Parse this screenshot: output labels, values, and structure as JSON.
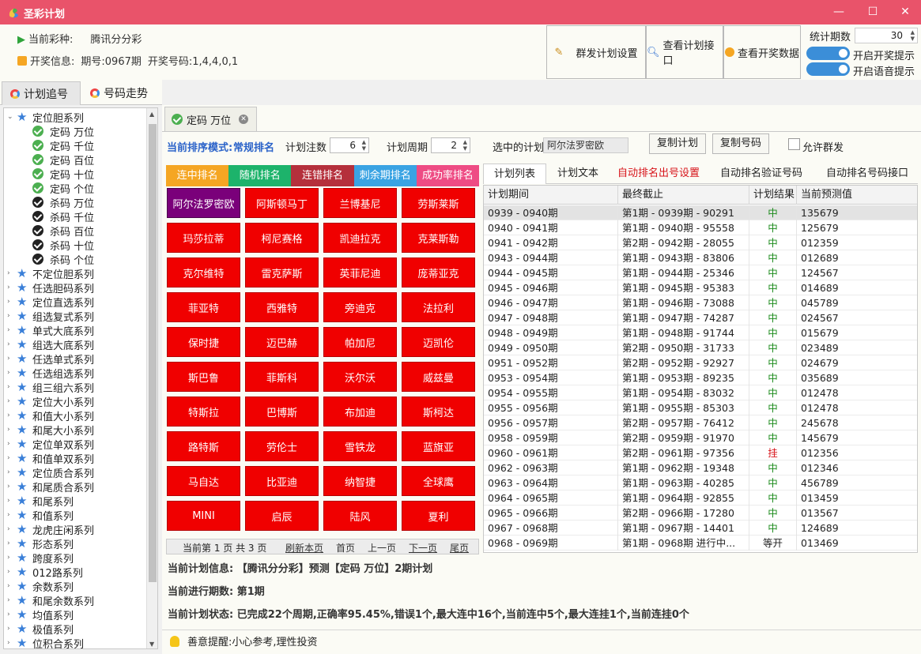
{
  "app": {
    "title": "圣彩计划"
  },
  "window": {
    "minimize": "—",
    "maximize": "☐",
    "close": "✕"
  },
  "info": {
    "lottery_label": "当前彩种:",
    "lottery_value": "腾讯分分彩",
    "draw_label": "开奖信息:",
    "draw_issue": "期号:0967期",
    "draw_code": "开奖号码:1,4,4,0,1"
  },
  "toolbar": {
    "group_settings": "群发计划设置",
    "view_api": "查看计划接口",
    "view_data": "查看开奖数据",
    "stat_label": "统计期数",
    "stat_value": "30",
    "toggle1": "开启开奖提示",
    "toggle2": "开启语音提示"
  },
  "left_tabs": [
    "计划追号",
    "号码走势"
  ],
  "tree": [
    {
      "label": "定位胆系列",
      "type": "group",
      "expanded": true
    },
    {
      "label": "定码 万位",
      "type": "child",
      "check": "green"
    },
    {
      "label": "定码 千位",
      "type": "child",
      "check": "green"
    },
    {
      "label": "定码 百位",
      "type": "child",
      "check": "green"
    },
    {
      "label": "定码 十位",
      "type": "child",
      "check": "green"
    },
    {
      "label": "定码 个位",
      "type": "child",
      "check": "green"
    },
    {
      "label": "杀码 万位",
      "type": "child",
      "check": "black"
    },
    {
      "label": "杀码 千位",
      "type": "child",
      "check": "black"
    },
    {
      "label": "杀码 百位",
      "type": "child",
      "check": "black"
    },
    {
      "label": "杀码 十位",
      "type": "child",
      "check": "black"
    },
    {
      "label": "杀码 个位",
      "type": "child",
      "check": "black"
    },
    {
      "label": "不定位胆系列",
      "type": "group"
    },
    {
      "label": "任选胆码系列",
      "type": "group"
    },
    {
      "label": "定位直选系列",
      "type": "group"
    },
    {
      "label": "组选复式系列",
      "type": "group"
    },
    {
      "label": "单式大底系列",
      "type": "group"
    },
    {
      "label": "组选大底系列",
      "type": "group"
    },
    {
      "label": "任选单式系列",
      "type": "group"
    },
    {
      "label": "任选组选系列",
      "type": "group"
    },
    {
      "label": "组三组六系列",
      "type": "group"
    },
    {
      "label": "定位大小系列",
      "type": "group"
    },
    {
      "label": "和值大小系列",
      "type": "group"
    },
    {
      "label": "和尾大小系列",
      "type": "group"
    },
    {
      "label": "定位单双系列",
      "type": "group"
    },
    {
      "label": "和值单双系列",
      "type": "group"
    },
    {
      "label": "定位质合系列",
      "type": "group"
    },
    {
      "label": "和尾质合系列",
      "type": "group"
    },
    {
      "label": "和尾系列",
      "type": "group"
    },
    {
      "label": "和值系列",
      "type": "group"
    },
    {
      "label": "龙虎庄闲系列",
      "type": "group"
    },
    {
      "label": "形态系列",
      "type": "group"
    },
    {
      "label": "跨度系列",
      "type": "group"
    },
    {
      "label": "012路系列",
      "type": "group"
    },
    {
      "label": "余数系列",
      "type": "group"
    },
    {
      "label": "和尾余数系列",
      "type": "group"
    },
    {
      "label": "均值系列",
      "type": "group"
    },
    {
      "label": "极值系列",
      "type": "group"
    },
    {
      "label": "位积合系列",
      "type": "group"
    }
  ],
  "plan_tab": "定码 万位",
  "controls": {
    "mode_label": "当前排序模式:",
    "mode_value": "常规排名",
    "bets_label": "计划注数",
    "bets_value": "6",
    "cycle_label": "计划周期",
    "cycle_value": "2",
    "selected_label": "选中的计划",
    "selected_value": "阿尔法罗密欧",
    "copy_plan": "复制计划",
    "copy_code": "复制号码",
    "allow_group": "允许群发"
  },
  "rank_tabs": [
    {
      "label": "连中排名",
      "color": "#f5a623"
    },
    {
      "label": "随机排名",
      "color": "#1db36b"
    },
    {
      "label": "连错排名",
      "color": "#b5303c"
    },
    {
      "label": "刺余期排名",
      "color": "#3aa3e3"
    },
    {
      "label": "成功率排名",
      "color": "#ee4c84"
    }
  ],
  "plans": [
    "阿尔法罗密欧",
    "阿斯顿马丁",
    "兰博基尼",
    "劳斯莱斯",
    "玛莎拉蒂",
    "柯尼赛格",
    "凯迪拉克",
    "克莱斯勒",
    "克尔维特",
    "雷克萨斯",
    "英菲尼迪",
    "庞蒂亚克",
    "菲亚特",
    "西雅特",
    "旁迪克",
    "法拉利",
    "保时捷",
    "迈巴赫",
    "帕加尼",
    "迈凯伦",
    "斯巴鲁",
    "菲斯科",
    "沃尔沃",
    "威兹曼",
    "特斯拉",
    "巴博斯",
    "布加迪",
    "斯柯达",
    "路特斯",
    "劳伦士",
    "雪铁龙",
    "蓝旗亚",
    "马自达",
    "比亚迪",
    "纳智捷",
    "全球鹰",
    "MINI",
    "启辰",
    "陆风",
    "夏利"
  ],
  "pager": {
    "status": "当前第 1 页 共 3 页",
    "refresh": "刷新本页",
    "first": "首页",
    "prev": "上一页",
    "next": "下一页",
    "last": "尾页"
  },
  "list_tabs": [
    "计划列表",
    "计划文本",
    "自动排名出号设置",
    "自动排名验证号码",
    "自动排名号码接口"
  ],
  "table": {
    "headers": [
      "计划期间",
      "最终截止",
      "计划结果",
      "当前预测值"
    ],
    "rows": [
      [
        "0939 - 0940期",
        "第1期 - 0939期 - 90291",
        "中",
        "135679"
      ],
      [
        "0940 - 0941期",
        "第1期 - 0940期 - 95558",
        "中",
        "125679"
      ],
      [
        "0941 - 0942期",
        "第2期 - 0942期 - 28055",
        "中",
        "012359"
      ],
      [
        "0943 - 0944期",
        "第1期 - 0943期 - 83806",
        "中",
        "012689"
      ],
      [
        "0944 - 0945期",
        "第1期 - 0944期 - 25346",
        "中",
        "124567"
      ],
      [
        "0945 - 0946期",
        "第1期 - 0945期 - 95383",
        "中",
        "014689"
      ],
      [
        "0946 - 0947期",
        "第1期 - 0946期 - 73088",
        "中",
        "045789"
      ],
      [
        "0947 - 0948期",
        "第1期 - 0947期 - 74287",
        "中",
        "024567"
      ],
      [
        "0948 - 0949期",
        "第1期 - 0948期 - 91744",
        "中",
        "015679"
      ],
      [
        "0949 - 0950期",
        "第2期 - 0950期 - 31733",
        "中",
        "023489"
      ],
      [
        "0951 - 0952期",
        "第2期 - 0952期 - 92927",
        "中",
        "024679"
      ],
      [
        "0953 - 0954期",
        "第1期 - 0953期 - 89235",
        "中",
        "035689"
      ],
      [
        "0954 - 0955期",
        "第1期 - 0954期 - 83032",
        "中",
        "012478"
      ],
      [
        "0955 - 0956期",
        "第1期 - 0955期 - 85303",
        "中",
        "012478"
      ],
      [
        "0956 - 0957期",
        "第2期 - 0957期 - 76412",
        "中",
        "245678"
      ],
      [
        "0958 - 0959期",
        "第2期 - 0959期 - 91970",
        "中",
        "145679"
      ],
      [
        "0960 - 0961期",
        "第2期 - 0961期 - 97356",
        "挂",
        "012356"
      ],
      [
        "0962 - 0963期",
        "第1期 - 0962期 - 19348",
        "中",
        "012346"
      ],
      [
        "0963 - 0964期",
        "第1期 - 0963期 - 40285",
        "中",
        "456789"
      ],
      [
        "0964 - 0965期",
        "第1期 - 0964期 - 92855",
        "中",
        "013459"
      ],
      [
        "0965 - 0966期",
        "第2期 - 0966期 - 17280",
        "中",
        "013567"
      ],
      [
        "0967 - 0968期",
        "第1期 - 0967期 - 14401",
        "中",
        "124689"
      ],
      [
        "0968 - 0969期",
        "第1期 - 0968期 进行中...",
        "等开",
        "013469"
      ]
    ]
  },
  "bottom": {
    "plan_info": "当前计划信息: 【腾讯分分彩】预测【定码 万位】2期计划",
    "progress": "当前进行期数: 第1期",
    "status": "当前计划状态: 已完成22个周期,正确率95.45%,错误1个,最大连中16个,当前连中5个,最大连挂1个,当前连挂0个",
    "tip": "善意提醒:小心参考,理性投资"
  }
}
